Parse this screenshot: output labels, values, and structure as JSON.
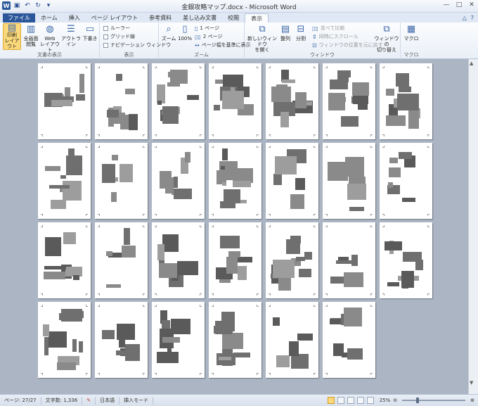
{
  "window": {
    "title": "金銀攻略マップ.docx - Microsoft Word",
    "controls": [
      "—",
      "□",
      "✕"
    ]
  },
  "tabs": [
    {
      "label": "ファイル",
      "kind": "file"
    },
    {
      "label": "ホーム",
      "kind": "normal"
    },
    {
      "label": "挿入",
      "kind": "normal"
    },
    {
      "label": "ページ レイアウト",
      "kind": "normal"
    },
    {
      "label": "参考資料",
      "kind": "normal"
    },
    {
      "label": "差し込み文書",
      "kind": "normal"
    },
    {
      "label": "校閲",
      "kind": "normal"
    },
    {
      "label": "表示",
      "kind": "active"
    }
  ],
  "ribbon": {
    "views": {
      "label": "文書の表示",
      "print_layout": "印刷\nレイアウト",
      "full_screen": "全画面\n閲覧",
      "web_layout": "Web\nレイアウト",
      "outline": "アウトライン",
      "draft": "下書き"
    },
    "show": {
      "label": "表示",
      "ruler": "ルーラー",
      "gridlines": "グリッド線",
      "nav_pane": "ナビゲーション ウィンドウ"
    },
    "zoom": {
      "label": "ズーム",
      "zoom": "ズーム",
      "hundred": "100%",
      "one_page": "1 ページ",
      "two_pages": "2 ページ",
      "page_width": "ページ幅を基準に表示"
    },
    "window": {
      "label": "ウィンドウ",
      "new_window": "新しいウィンドウ\nを開く",
      "arrange": "整列",
      "split": "分割",
      "side_by_side": "並べて比較",
      "sync_scroll": "同時にスクロール",
      "reset_pos": "ウィンドウの位置を元に戻す",
      "switch": "ウィンドウの\n切り替え"
    },
    "macro": {
      "label": "マクロ",
      "macro": "マクロ"
    }
  },
  "status": {
    "page": "ページ: 27/27",
    "words": "文字数: 1,336",
    "lang": "日本語",
    "mode": "挿入モード",
    "zoom": "25%"
  },
  "document": {
    "page_count": 27,
    "columns": 7
  }
}
